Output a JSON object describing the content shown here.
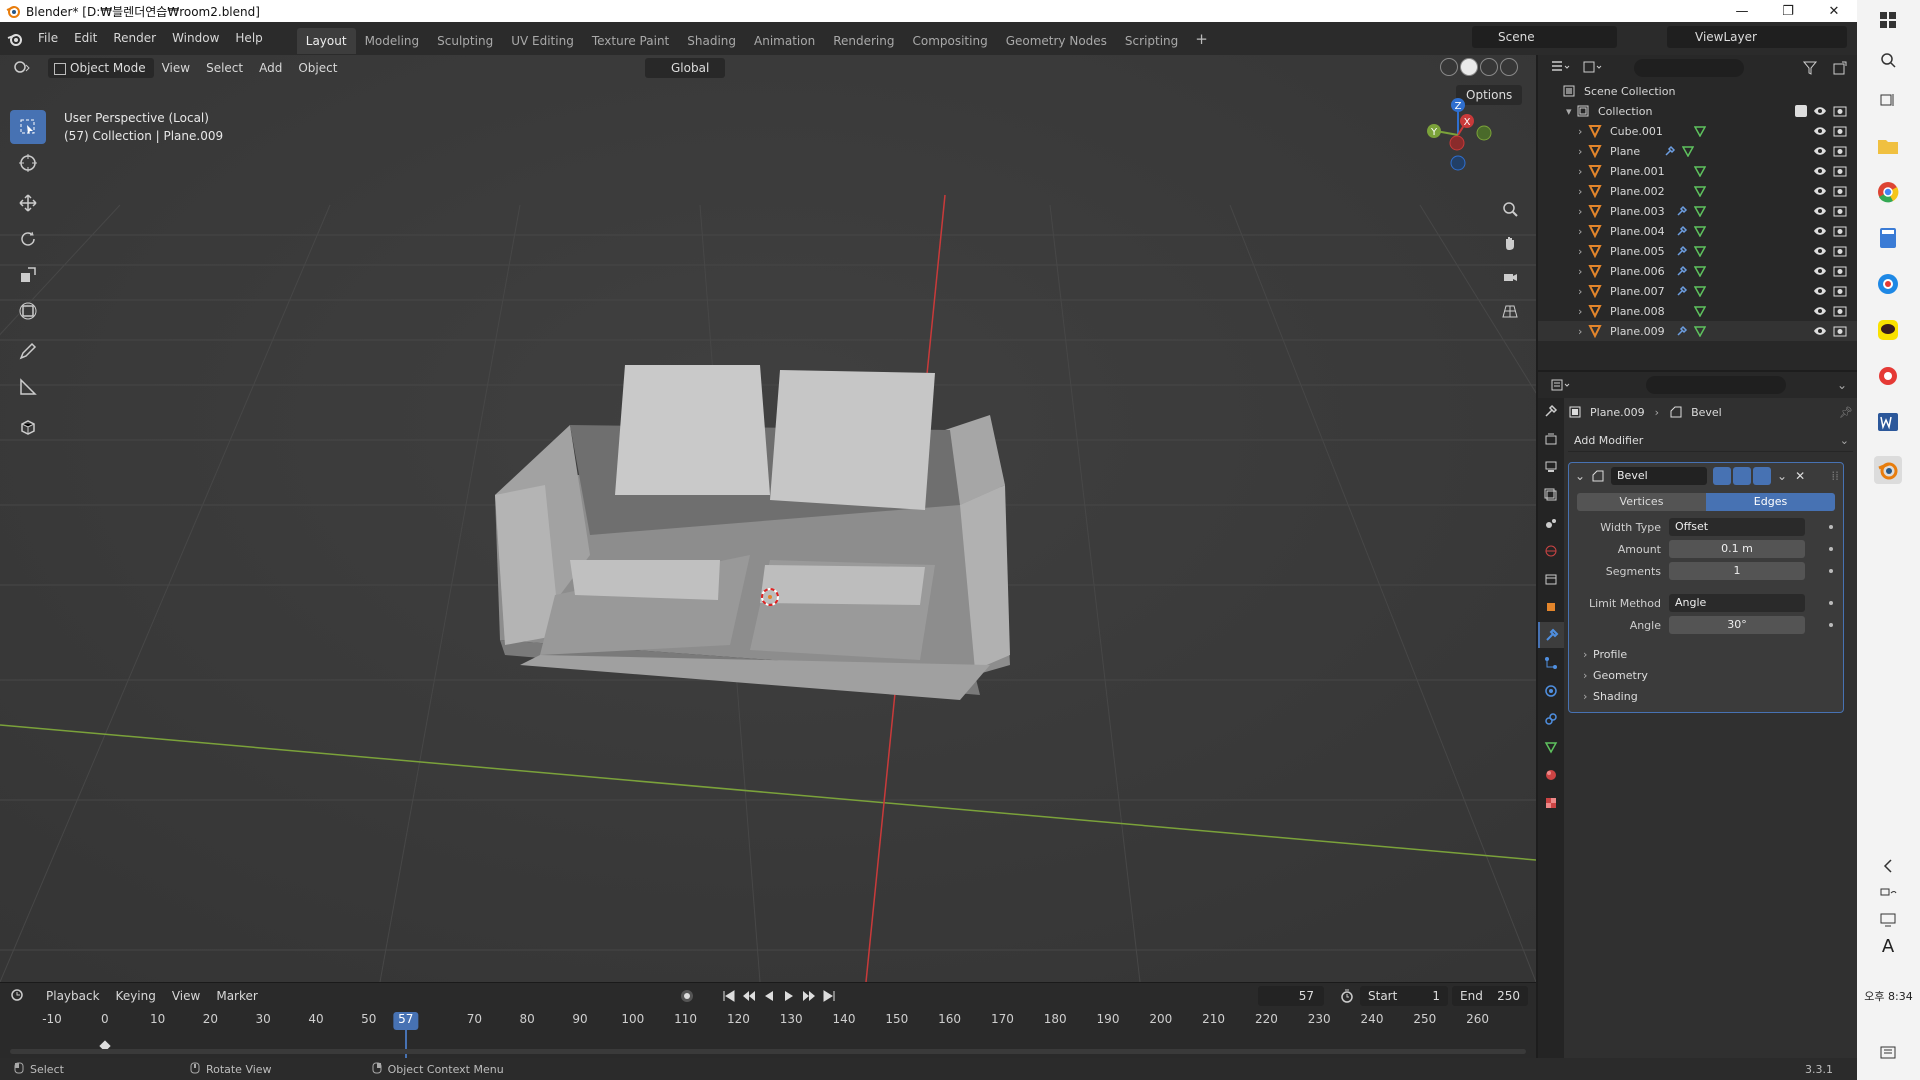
{
  "window": {
    "title": "Blender* [D:₩블렌더연습₩room2.blend]",
    "minimize": "—",
    "restore": "❐",
    "close": "✕"
  },
  "menu": [
    "File",
    "Edit",
    "Render",
    "Window",
    "Help"
  ],
  "workspaces": [
    "Layout",
    "Modeling",
    "Sculpting",
    "UV Editing",
    "Texture Paint",
    "Shading",
    "Animation",
    "Rendering",
    "Compositing",
    "Geometry Nodes",
    "Scripting"
  ],
  "workspace_add": "+",
  "scene_name": "Scene",
  "view_layer": "ViewLayer",
  "viewport": {
    "mode": "Object Mode",
    "menus": [
      "View",
      "Select",
      "Add",
      "Object"
    ],
    "transform_orientation": "Global",
    "options": "Options",
    "info_line1": "User Perspective (Local)",
    "info_line2": "(57) Collection | Plane.009",
    "gizmo_x": "X",
    "gizmo_y": "Y",
    "gizmo_z": "Z"
  },
  "outliner": {
    "root": "Scene Collection",
    "collection": "Collection",
    "objects": [
      "Cube.001",
      "Plane",
      "Plane.001",
      "Plane.002",
      "Plane.003",
      "Plane.004",
      "Plane.005",
      "Plane.006",
      "Plane.007",
      "Plane.008",
      "Plane.009"
    ]
  },
  "properties": {
    "object": "Plane.009",
    "modifier_crumb": "Bevel",
    "add_modifier": "Add Modifier",
    "modifier_name": "Bevel",
    "affect_vertices": "Vertices",
    "affect_edges": "Edges",
    "width_type_label": "Width Type",
    "width_type": "Offset",
    "amount_label": "Amount",
    "amount": "0.1 m",
    "segments_label": "Segments",
    "segments": "1",
    "limit_method_label": "Limit Method",
    "limit_method": "Angle",
    "angle_label": "Angle",
    "angle": "30°",
    "subpanels": [
      "Profile",
      "Geometry",
      "Shading"
    ]
  },
  "timeline": {
    "menus": [
      "Playback",
      "Keying",
      "View",
      "Marker"
    ],
    "current_frame": "57",
    "start_label": "Start",
    "start": "1",
    "end_label": "End",
    "end": "250",
    "ticks": [
      "-10",
      "0",
      "10",
      "20",
      "30",
      "40",
      "50",
      "70",
      "80",
      "90",
      "100",
      "110",
      "120",
      "130",
      "140",
      "150",
      "160",
      "170",
      "180",
      "190",
      "200",
      "210",
      "220",
      "230",
      "240",
      "250",
      "260"
    ]
  },
  "status": {
    "left": "Select",
    "mid": "Rotate View",
    "right": "Object Context Menu",
    "version": "3.3.1"
  },
  "taskbar": {
    "time": "오후 8:34",
    "lang": "A"
  },
  "colors": {
    "accent": "#4772b3",
    "x_axis": "#c93a3a",
    "y_axis": "#7ba23a",
    "z_axis": "#2f6fcf",
    "object_orange": "#e3852b",
    "mesh_green": "#5ec25e"
  }
}
